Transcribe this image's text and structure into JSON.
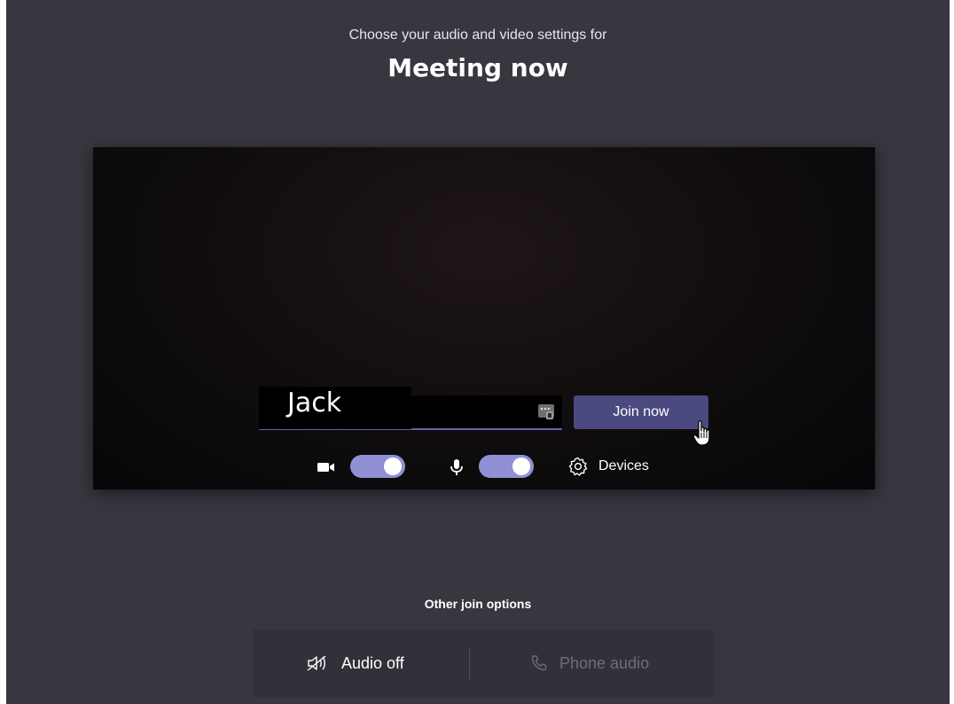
{
  "header": {
    "subtitle": "Choose your audio and video settings for",
    "title": "Meeting now"
  },
  "preview": {
    "name_value": "Jack",
    "join_label": "Join now",
    "camera_on": true,
    "mic_on": true,
    "devices_label": "Devices"
  },
  "other_options": {
    "label": "Other join options",
    "audio_off_label": "Audio off",
    "phone_audio_label": "Phone audio"
  },
  "icons": {
    "camera": "camera-icon",
    "mic": "microphone-icon",
    "settings": "gear-icon",
    "background": "background-effects-icon",
    "audio_off": "speaker-off-icon",
    "phone": "phone-icon"
  },
  "colors": {
    "background": "#38373f",
    "accent": "#6264a7",
    "toggle_on": "#8f91d4",
    "join_button": "#4b4a7f"
  }
}
